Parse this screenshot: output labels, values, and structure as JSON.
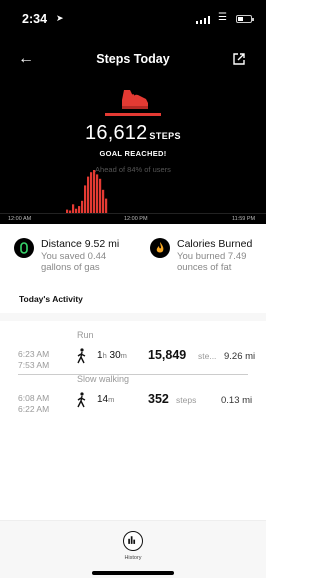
{
  "status_bar": {
    "time": "2:34",
    "location_icon": "location-arrow-icon",
    "signal_icon": "signal-icon",
    "wifi_icon": "wifi-icon",
    "battery_icon": "battery-icon"
  },
  "nav": {
    "title": "Steps Today",
    "back_icon": "back-arrow-icon",
    "share_icon": "share-icon"
  },
  "summary": {
    "steps": "16,612",
    "steps_unit": "STEPS",
    "goal_text": "GOAL REACHED!",
    "ahead_text": "Ahead of 84% of users",
    "accent": "#e43a33"
  },
  "timeline": {
    "start": "12:00 AM",
    "mid": "12:00 PM",
    "end": "11:59 PM"
  },
  "chart_data": {
    "type": "bar",
    "title": "",
    "xlabel": "",
    "ylabel": "",
    "x_ticks": [
      "12:00 AM",
      "12:00 PM",
      "11:59 PM"
    ],
    "bar_color": "#e43a33",
    "series": [
      {
        "values": [
          0.1,
          0.08,
          0.22,
          0.12,
          0.18,
          0.3,
          0.65,
          0.85,
          0.95,
          1.0,
          0.9,
          0.8,
          0.55,
          0.35
        ]
      }
    ]
  },
  "cards": {
    "distance": {
      "title": "Distance 9.52 mi",
      "subtitle": "You saved 0.44 gallons of gas",
      "icon": "shoe-icon"
    },
    "calories": {
      "title": "Calories Burned",
      "subtitle": "You burned 7.49 ounces of fat",
      "icon": "flame-icon"
    }
  },
  "activity_section": {
    "label": "Today's Activity"
  },
  "activities": [
    {
      "type": "Run",
      "start": "6:23 AM",
      "end": "7:53 AM",
      "dur_h": "1",
      "dur_h_unit": "h",
      "dur_m": "30",
      "dur_m_unit": "m",
      "steps": "15,849",
      "steps_label": "ste...",
      "distance": "9.26 mi"
    },
    {
      "type": "Slow walking",
      "start": "6:08 AM",
      "end": "6:22 AM",
      "dur_m": "14",
      "dur_m_unit": "m",
      "steps": "352",
      "steps_label": "steps",
      "distance": "0.13 mi"
    }
  ],
  "tabbar": {
    "history_label": "History",
    "history_icon": "bar-chart-icon"
  }
}
